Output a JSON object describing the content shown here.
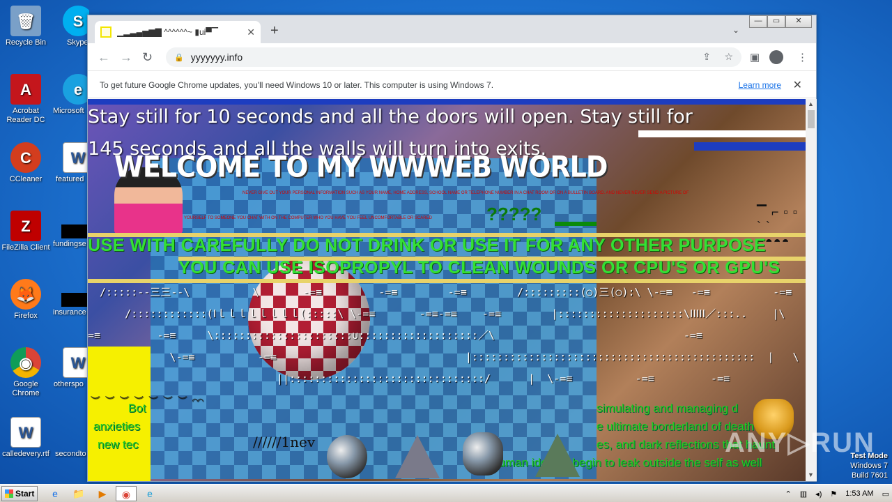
{
  "desktop": {
    "icons": [
      {
        "label": "Recycle Bin",
        "glyph": "🗑"
      },
      {
        "label": "Skype",
        "glyph": "S"
      },
      {
        "label": "Acrobat Reader DC",
        "glyph": "A"
      },
      {
        "label": "Microsoft",
        "glyph": "e"
      },
      {
        "label": "CCleaner",
        "glyph": "C"
      },
      {
        "label": "featured",
        "glyph": "W"
      },
      {
        "label": "FileZilla Client",
        "glyph": "Z"
      },
      {
        "label": "fundingse",
        "glyph": ""
      },
      {
        "label": "Firefox",
        "glyph": "🦊"
      },
      {
        "label": "insurance",
        "glyph": ""
      },
      {
        "label": "Google Chrome",
        "glyph": "◉"
      },
      {
        "label": "otherspo",
        "glyph": "W"
      },
      {
        "label": "calledevery.rtf",
        "glyph": "W"
      },
      {
        "label": "secondto",
        "glyph": ""
      }
    ]
  },
  "browser": {
    "tab_title": "▁▂▃▄▅▆▇ ^^^^^^~ ▮ui▀▔",
    "tab_close": "✕",
    "new_tab": "+",
    "tab_search": "⌄",
    "win_min": "—",
    "win_max": "▭",
    "win_close": "✕",
    "nav_back": "←",
    "nav_forward": "→",
    "nav_reload": "↻",
    "url": "yyyyyyy.info",
    "lock_icon": "🔒",
    "infobar_message": "To get future Google Chrome updates, you'll need Windows 10 or later. This computer is using Windows 7.",
    "infobar_link": "Learn more",
    "infobar_close": "✕"
  },
  "page": {
    "line1": "Stay still for 10 seconds and all the doors will open. Stay still for",
    "line2": "145 seconds and all the walls will turn into exits.",
    "welcome": "WELCOME TO MY  WWWEB WORLD",
    "red_line1": "NEVER GIVE OUT YOUR PERSONAL INFORMATION SUCH AS YOUR NAME, HOME ADDRESS, SCHOOL NAME OR TELEPHONE NUMBER IN A CHAT ROOM OR ON A BULLETIN BOARD. AND NEVER NEVER SEND A PICTURE OF",
    "red_line2": "YOURSELF TO SOMEONE YOU CHAT WITH ON THE COMPUTER WHO YOU HAVE YOU FEEL UNCOMFORTABLE OR SCARED",
    "qmarks": "?????",
    "dots": "▔ ⌐ ▫ ▫ ` ` ◓◓◓◓",
    "green_line1": "USE WITH CAREFULLY DO NOT DRINK OR USE IT FOR ANY OTHER PURPOSE",
    "green_line2": "YOU CAN USE ISOPROPYL TO CLEAN WOUNDS OR CPU'S OR GPU'S",
    "ascii_1": " /:::::--三三--\\          \\       -=≡         -=≡        -=≡        /:::::::::(○)三(○):\\ \\-=≡   -=≡          -=≡",
    "ascii_2": "     /::::::::::::(Ⅰｌｌｌｌｌｌｌｌ(:::::\\ \\-=≡       -=≡-=≡    -=≡        |::::::::::::::::::::\\ⅠⅠⅠⅠⅠ／:::..    |\\       -=≡           -",
    "ascii_3": "=≡         -=≡     \\::::::::::::::::::::::∪:::::::::::::::::::／\\                              -=≡                     >::::::::::::::::::::::::::::::::::::<",
    "ascii_4": "             \\-=≡          -=≡                              |:::::::::::::::::::::::::::::::::::::::::::::  |   \\       -=≡          -=≡           -=≡",
    "ascii_5": "                              ||:::::::::::::::::::::::::::::::/      |  \\-=≡          -=≡         -=≡                     ||::::::::::::::::::::::::::::/  |  |",
    "green_left": "Bot",
    "green_left2": "anxieties",
    "green_left3": "new tec",
    "green_right1": "simulating and managing d",
    "green_right2": "e ultimate borderland of death",
    "green_right3": "es, and dark reflections that haunt",
    "green_right4": "human identity begin to leak outside the self as well",
    "slash_text": "//////1nev",
    "ascii_left": "︶ ︶ ︶ ︶ ︶ ︶ ︶ ◠◠"
  },
  "overlay": {
    "watermark": "ANY▷RUN",
    "test_mode": "Test Mode",
    "windows": "Windows 7",
    "build": "Build 7601"
  },
  "taskbar": {
    "start_label": "Start",
    "apps": [
      "e",
      "📁",
      "▶",
      "◉",
      "e"
    ],
    "tray_arrow": "⌃",
    "time": "1:53 AM"
  }
}
